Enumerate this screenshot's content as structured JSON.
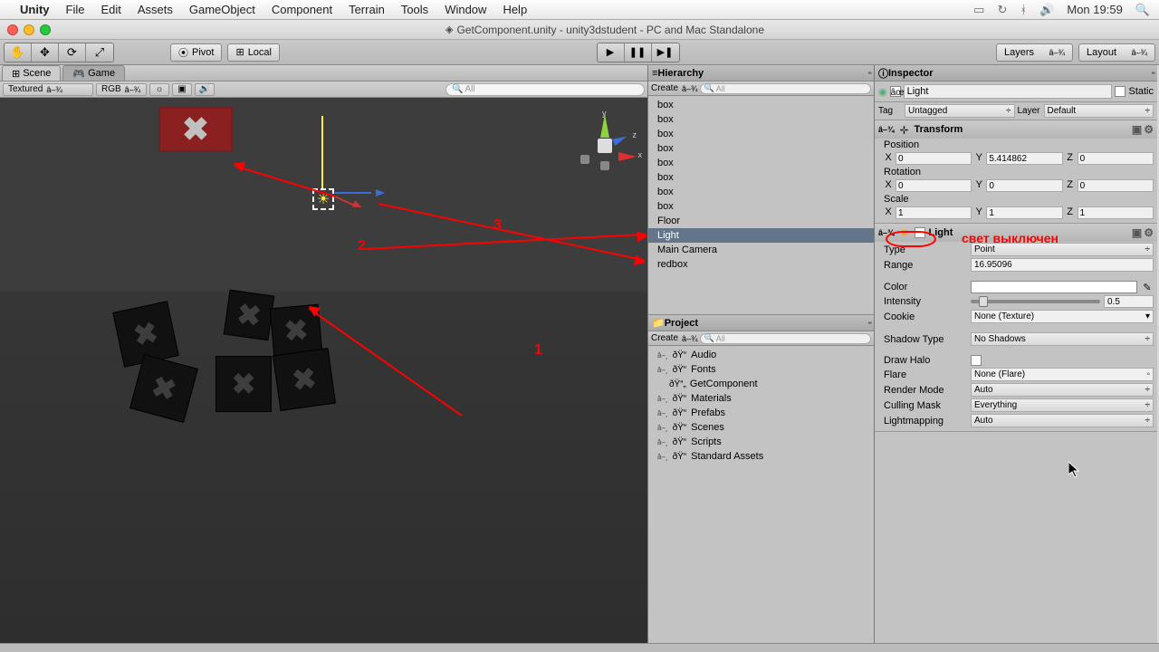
{
  "menubar": {
    "items": [
      "Unity",
      "File",
      "Edit",
      "Assets",
      "GameObject",
      "Component",
      "Terrain",
      "Tools",
      "Window",
      "Help"
    ],
    "clock": "Mon 19:59"
  },
  "window": {
    "title": "GetComponent.unity - unity3dstudent - PC and Mac Standalone"
  },
  "toolbar": {
    "pivot": "Pivot",
    "local": "Local",
    "layers": "Layers",
    "layout": "Layout"
  },
  "sceneTabs": {
    "scene": "Scene",
    "game": "Game"
  },
  "sceneToolbar": {
    "shading": "Textured",
    "color": "RGB",
    "searchPlaceholder": "All"
  },
  "sceneGizmo": {
    "x": "x",
    "y": "y",
    "z": "z"
  },
  "hierarchy": {
    "title": "Hierarchy",
    "create": "Create",
    "searchPlaceholder": "All",
    "items": [
      "box",
      "box",
      "box",
      "box",
      "box",
      "box",
      "box",
      "box",
      "Floor",
      "Light",
      "Main Camera",
      "redbox"
    ],
    "selectedIndex": 9
  },
  "project": {
    "title": "Project",
    "create": "Create",
    "searchPlaceholder": "All",
    "items": [
      {
        "label": "Audio",
        "type": "folder",
        "expand": true
      },
      {
        "label": "Fonts",
        "type": "folder",
        "expand": true
      },
      {
        "label": "GetComponent",
        "type": "script",
        "expand": false
      },
      {
        "label": "Materials",
        "type": "folder",
        "expand": true
      },
      {
        "label": "Prefabs",
        "type": "folder",
        "expand": true
      },
      {
        "label": "Scenes",
        "type": "folder",
        "expand": true
      },
      {
        "label": "Scripts",
        "type": "folder",
        "expand": true
      },
      {
        "label": "Standard Assets",
        "type": "folder",
        "expand": true
      }
    ]
  },
  "inspector": {
    "title": "Inspector",
    "objectName": "Light",
    "staticLabel": "Static",
    "tagLabel": "Tag",
    "tagValue": "Untagged",
    "layerLabel": "Layer",
    "layerValue": "Default",
    "transform": {
      "title": "Transform",
      "positionLabel": "Position",
      "rotationLabel": "Rotation",
      "scaleLabel": "Scale",
      "position": {
        "x": "0",
        "y": "5.414862",
        "z": "0"
      },
      "rotation": {
        "x": "0",
        "y": "0",
        "z": "0"
      },
      "scale": {
        "x": "1",
        "y": "1",
        "z": "1"
      }
    },
    "light": {
      "title": "Light",
      "typeLabel": "Type",
      "typeValue": "Point",
      "rangeLabel": "Range",
      "rangeValue": "16.95096",
      "colorLabel": "Color",
      "intensityLabel": "Intensity",
      "intensityValue": "0.5",
      "cookieLabel": "Cookie",
      "cookieValue": "None (Texture)",
      "shadowLabel": "Shadow Type",
      "shadowValue": "No Shadows",
      "drawHaloLabel": "Draw Halo",
      "flareLabel": "Flare",
      "flareValue": "None (Flare)",
      "renderModeLabel": "Render Mode",
      "renderModeValue": "Auto",
      "cullingLabel": "Culling Mask",
      "cullingValue": "Everything",
      "lightmapLabel": "Lightmapping",
      "lightmapValue": "Auto"
    }
  },
  "annotations": {
    "n1": "1",
    "n2": "2",
    "n3": "3",
    "lightOff": "свет выключен"
  }
}
